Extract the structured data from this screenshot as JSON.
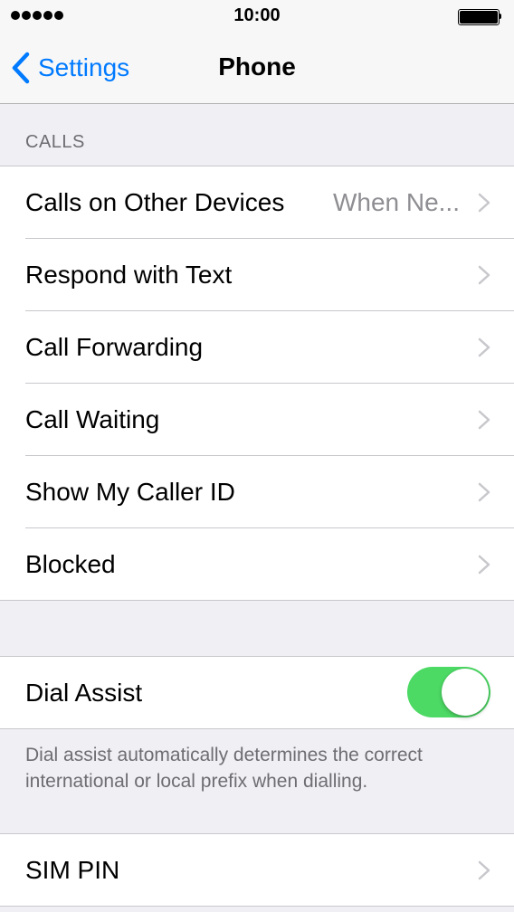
{
  "status_bar": {
    "time": "10:00",
    "signal_dots": 5
  },
  "nav": {
    "back_label": "Settings",
    "title": "Phone"
  },
  "calls_section": {
    "header": "CALLS",
    "rows": [
      {
        "label": "Calls on Other Devices",
        "value": "When Ne..."
      },
      {
        "label": "Respond with Text"
      },
      {
        "label": "Call Forwarding"
      },
      {
        "label": "Call Waiting"
      },
      {
        "label": "Show My Caller ID"
      },
      {
        "label": "Blocked"
      }
    ]
  },
  "dial_assist": {
    "label": "Dial Assist",
    "enabled": true,
    "footer": "Dial assist automatically determines the correct international or local prefix when dialling."
  },
  "sim_section": {
    "label": "SIM PIN"
  },
  "colors": {
    "accent": "#007aff",
    "toggle_on": "#4cd964",
    "background": "#efeff4"
  }
}
